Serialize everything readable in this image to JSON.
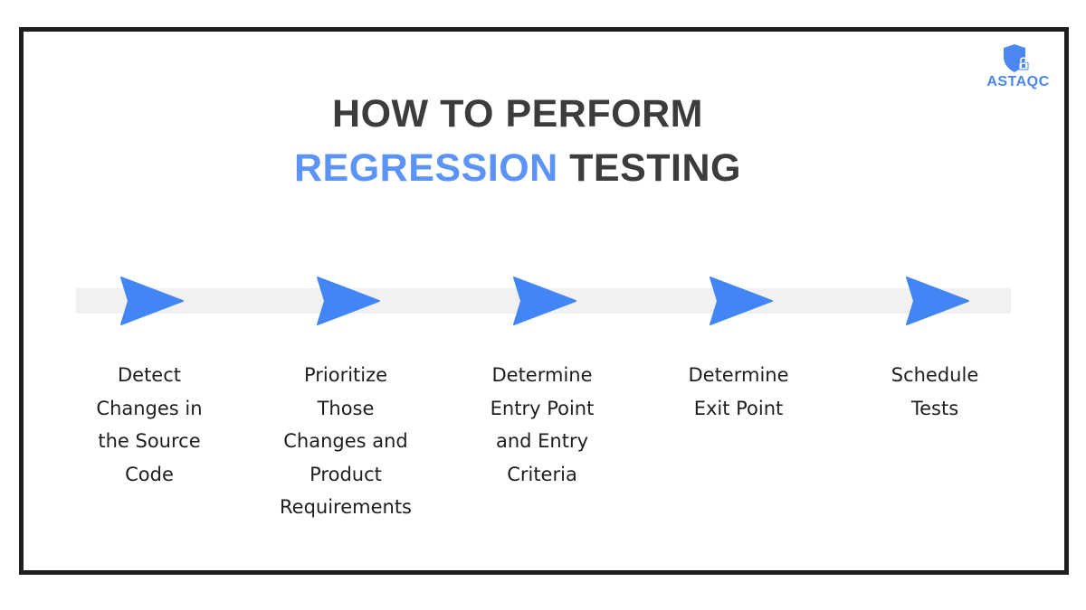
{
  "brand": {
    "logo_icon": "shield-lock-icon",
    "name": "ASTAQC",
    "color": "#4a87f0"
  },
  "title": {
    "line1": "HOW TO PERFORM",
    "line2_accent": "REGRESSION",
    "line2_rest": " TESTING",
    "accent_color": "#5b93f6",
    "text_color": "#3c3c3c"
  },
  "arrow_icon": "arrow-right-icon",
  "arrow_color": "#4285f4",
  "steps": [
    {
      "lines": [
        "Detect",
        "Changes in",
        "the Source",
        "Code"
      ]
    },
    {
      "lines": [
        "Prioritize",
        "Those",
        "Changes and",
        "Product",
        "Requirements"
      ]
    },
    {
      "lines": [
        "Determine",
        "Entry Point",
        "and Entry",
        "Criteria"
      ]
    },
    {
      "lines": [
        "Determine",
        "Exit Point"
      ]
    },
    {
      "lines": [
        "Schedule",
        "Tests"
      ]
    }
  ]
}
